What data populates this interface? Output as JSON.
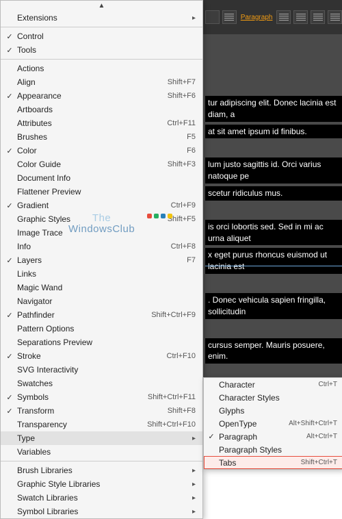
{
  "toolbar": {
    "paragraph_label": "Paragraph"
  },
  "canvas": {
    "blocks": [
      "tur adipiscing elit. Donec lacinia est diam, a",
      "at sit amet ipsum id finibus.",
      "lum justo sagittis id. Orci varius natoque pe",
      "scetur ridiculus mus.",
      "is orci lobortis sed. Sed in mi ac urna aliquet",
      "x eget purus rhoncus euismod ut lacinia est",
      ". Donec vehicula sapien fringilla, sollicitudin",
      "cursus semper. Mauris posuere, enim."
    ]
  },
  "menu": {
    "top_section": [
      {
        "label": "Extensions",
        "checked": false,
        "shortcut": "",
        "submenu": true
      }
    ],
    "control_tools": [
      {
        "label": "Control",
        "checked": true,
        "shortcut": "",
        "submenu": false
      },
      {
        "label": "Tools",
        "checked": true,
        "shortcut": "",
        "submenu": false
      }
    ],
    "panels": [
      {
        "label": "Actions",
        "checked": false,
        "shortcut": "",
        "submenu": false
      },
      {
        "label": "Align",
        "checked": false,
        "shortcut": "Shift+F7",
        "submenu": false
      },
      {
        "label": "Appearance",
        "checked": true,
        "shortcut": "Shift+F6",
        "submenu": false
      },
      {
        "label": "Artboards",
        "checked": false,
        "shortcut": "",
        "submenu": false
      },
      {
        "label": "Attributes",
        "checked": false,
        "shortcut": "Ctrl+F11",
        "submenu": false
      },
      {
        "label": "Brushes",
        "checked": false,
        "shortcut": "F5",
        "submenu": false
      },
      {
        "label": "Color",
        "checked": true,
        "shortcut": "F6",
        "submenu": false
      },
      {
        "label": "Color Guide",
        "checked": false,
        "shortcut": "Shift+F3",
        "submenu": false
      },
      {
        "label": "Document Info",
        "checked": false,
        "shortcut": "",
        "submenu": false
      },
      {
        "label": "Flattener Preview",
        "checked": false,
        "shortcut": "",
        "submenu": false
      },
      {
        "label": "Gradient",
        "checked": true,
        "shortcut": "Ctrl+F9",
        "submenu": false
      },
      {
        "label": "Graphic Styles",
        "checked": false,
        "shortcut": "Shift+F5",
        "submenu": false
      },
      {
        "label": "Image Trace",
        "checked": false,
        "shortcut": "",
        "submenu": false
      },
      {
        "label": "Info",
        "checked": false,
        "shortcut": "Ctrl+F8",
        "submenu": false
      },
      {
        "label": "Layers",
        "checked": true,
        "shortcut": "F7",
        "submenu": false
      },
      {
        "label": "Links",
        "checked": false,
        "shortcut": "",
        "submenu": false
      },
      {
        "label": "Magic Wand",
        "checked": false,
        "shortcut": "",
        "submenu": false
      },
      {
        "label": "Navigator",
        "checked": false,
        "shortcut": "",
        "submenu": false
      },
      {
        "label": "Pathfinder",
        "checked": true,
        "shortcut": "Shift+Ctrl+F9",
        "submenu": false
      },
      {
        "label": "Pattern Options",
        "checked": false,
        "shortcut": "",
        "submenu": false
      },
      {
        "label": "Separations Preview",
        "checked": false,
        "shortcut": "",
        "submenu": false
      },
      {
        "label": "Stroke",
        "checked": true,
        "shortcut": "Ctrl+F10",
        "submenu": false
      },
      {
        "label": "SVG Interactivity",
        "checked": false,
        "shortcut": "",
        "submenu": false
      },
      {
        "label": "Swatches",
        "checked": false,
        "shortcut": "",
        "submenu": false
      },
      {
        "label": "Symbols",
        "checked": true,
        "shortcut": "Shift+Ctrl+F11",
        "submenu": false
      },
      {
        "label": "Transform",
        "checked": true,
        "shortcut": "Shift+F8",
        "submenu": false
      },
      {
        "label": "Transparency",
        "checked": false,
        "shortcut": "Shift+Ctrl+F10",
        "submenu": false
      },
      {
        "label": "Type",
        "checked": false,
        "shortcut": "",
        "submenu": true,
        "hovered": true
      },
      {
        "label": "Variables",
        "checked": false,
        "shortcut": "",
        "submenu": false
      }
    ],
    "libraries": [
      {
        "label": "Brush Libraries",
        "checked": false,
        "shortcut": "",
        "submenu": true
      },
      {
        "label": "Graphic Style Libraries",
        "checked": false,
        "shortcut": "",
        "submenu": true
      },
      {
        "label": "Swatch Libraries",
        "checked": false,
        "shortcut": "",
        "submenu": true
      },
      {
        "label": "Symbol Libraries",
        "checked": false,
        "shortcut": "",
        "submenu": true
      }
    ]
  },
  "submenu": {
    "items": [
      {
        "label": "Character",
        "checked": false,
        "shortcut": "Ctrl+T",
        "highlighted": false
      },
      {
        "label": "Character Styles",
        "checked": false,
        "shortcut": "",
        "highlighted": false
      },
      {
        "label": "Glyphs",
        "checked": false,
        "shortcut": "",
        "highlighted": false
      },
      {
        "label": "OpenType",
        "checked": false,
        "shortcut": "Alt+Shift+Ctrl+T",
        "highlighted": false
      },
      {
        "label": "Paragraph",
        "checked": true,
        "shortcut": "Alt+Ctrl+T",
        "highlighted": false
      },
      {
        "label": "Paragraph Styles",
        "checked": false,
        "shortcut": "",
        "highlighted": false
      },
      {
        "label": "Tabs",
        "checked": false,
        "shortcut": "Shift+Ctrl+T",
        "highlighted": true
      }
    ]
  },
  "watermark": {
    "line1": "The",
    "line2": "WindowsClub"
  },
  "colors": {
    "highlight_border": "#e74c3c",
    "highlight_bg": "#fdecea",
    "menu_bg": "#f5f5f5",
    "toolbar_bg": "#323232"
  }
}
